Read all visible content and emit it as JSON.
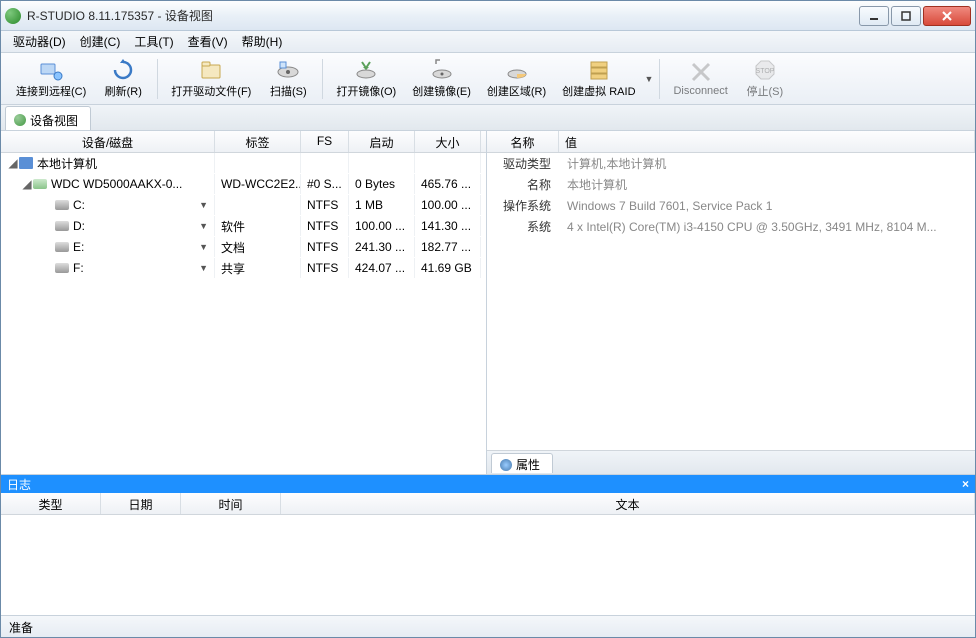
{
  "title": "R-STUDIO 8.11.175357 - 设备视图",
  "menu": {
    "drive": "驱动器(D)",
    "create": "创建(C)",
    "tools": "工具(T)",
    "view": "查看(V)",
    "help": "帮助(H)"
  },
  "toolbar": {
    "connect": "连接到远程(C)",
    "refresh": "刷新(R)",
    "open_drive_files": "打开驱动文件(F)",
    "scan": "扫描(S)",
    "open_image": "打开镜像(O)",
    "create_image": "创建镜像(E)",
    "create_region": "创建区域(R)",
    "create_virtual_raid": "创建虚拟 RAID",
    "disconnect": "Disconnect",
    "stop": "停止(S)"
  },
  "tab_device_view": "设备视图",
  "left_headers": {
    "device": "设备/磁盘",
    "label": "标签",
    "fs": "FS",
    "start": "启动",
    "size": "大小"
  },
  "tree": {
    "computer": "本地计算机",
    "wdc": {
      "name": "WDC WD5000AAKX-0...",
      "label": "WD-WCC2E2...",
      "fs": "#0 S...",
      "start": "0 Bytes",
      "size": "465.76 ..."
    },
    "c": {
      "name": "C:",
      "label": "",
      "fs": "NTFS",
      "start": "1 MB",
      "size": "100.00 ..."
    },
    "d": {
      "name": "D:",
      "label": "软件",
      "fs": "NTFS",
      "start": "100.00 ...",
      "size": "141.30 ..."
    },
    "e": {
      "name": "E:",
      "label": "文档",
      "fs": "NTFS",
      "start": "241.30 ...",
      "size": "182.77 ..."
    },
    "f": {
      "name": "F:",
      "label": "共享",
      "fs": "NTFS",
      "start": "424.07 ...",
      "size": "41.69 GB"
    }
  },
  "right_headers": {
    "name": "名称",
    "value": "值"
  },
  "props": {
    "drive_type_label": "驱动类型",
    "drive_type_value": "计算机,本地计算机",
    "name_label": "名称",
    "name_value": "本地计算机",
    "os_label": "操作系统",
    "os_value": "Windows 7 Build 7601, Service Pack 1",
    "system_label": "系统",
    "system_value": "4 x Intel(R) Core(TM) i3-4150 CPU @ 3.50GHz, 3491 MHz, 8104 M..."
  },
  "prop_tab": "属性",
  "log": {
    "title": "日志",
    "type": "类型",
    "date": "日期",
    "time": "时间",
    "text": "文本"
  },
  "status": "准备"
}
